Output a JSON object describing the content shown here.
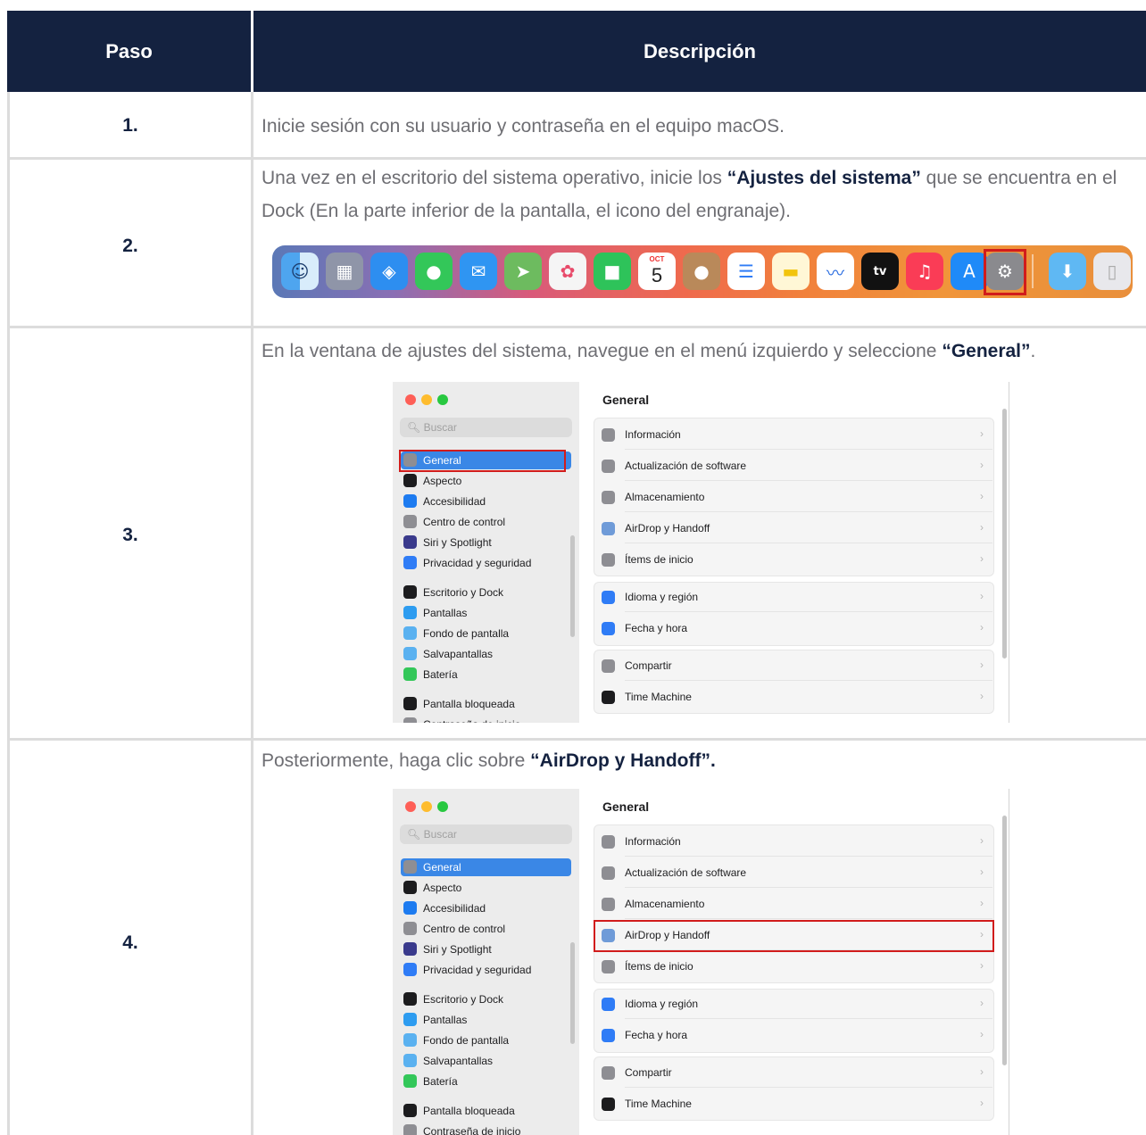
{
  "header": {
    "col_step": "Paso",
    "col_desc": "Descripción"
  },
  "rows": [
    {
      "num": "1.",
      "text": "Inicie sesión con su usuario y contraseña en el equipo macOS."
    },
    {
      "num": "2.",
      "pre": "Una vez en el escritorio del sistema operativo, inicie los ",
      "bold": "“Ajustes del sistema”",
      "post": " que se encuentra en el Dock (En la parte inferior de la pantalla, el icono del engranaje)."
    },
    {
      "num": "3.",
      "pre": "En la ventana de ajustes del sistema, navegue en el menú izquierdo y seleccione ",
      "bold": "“General”",
      "post": "."
    },
    {
      "num": "4.",
      "pre": "Posteriormente, haga clic sobre ",
      "bold": "“AirDrop y Handoff”.",
      "post": ""
    }
  ],
  "dock": {
    "calendar_month": "OCT",
    "calendar_day": "5",
    "tv_label": "tv",
    "apps": [
      "finder-icon",
      "launchpad-icon",
      "safari-icon",
      "messages-icon",
      "mail-icon",
      "maps-icon",
      "photos-icon",
      "facetime-icon",
      "calendar-icon",
      "contacts-icon",
      "reminders-icon",
      "notes-icon",
      "freeform-icon",
      "apple-tv-icon",
      "music-icon",
      "app-store-icon",
      "system-settings-icon",
      "downloads-icon",
      "trash-icon"
    ]
  },
  "settings": {
    "search_placeholder": "Buscar",
    "title": "General",
    "sidebar": [
      "General",
      "Aspecto",
      "Accesibilidad",
      "Centro de control",
      "Siri y Spotlight",
      "Privacidad y seguridad",
      "Escritorio y Dock",
      "Pantallas",
      "Fondo de pantalla",
      "Salvapantallas",
      "Batería",
      "Pantalla bloqueada",
      "Contraseña de inicio"
    ],
    "main": [
      "Información",
      "Actualización de software",
      "Almacenamiento",
      "AirDrop y Handoff",
      "Ítems de inicio",
      "Idioma y región",
      "Fecha y hora",
      "Compartir",
      "Time Machine"
    ],
    "chevron": "›"
  },
  "colors": {
    "header_bg": "#142240",
    "highlight": "#d11c1c",
    "selected": "#3a87e6"
  }
}
